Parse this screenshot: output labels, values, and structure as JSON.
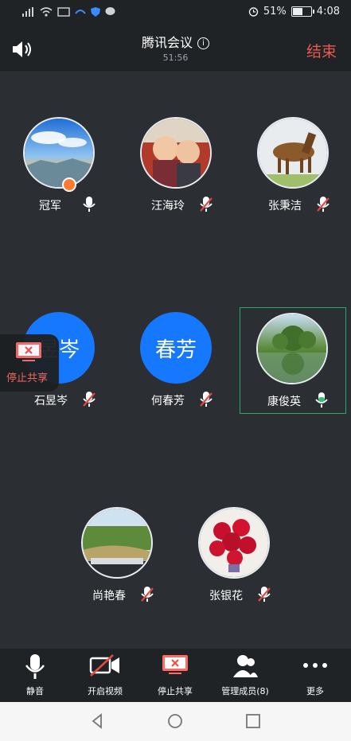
{
  "status": {
    "left_icons": [
      "signal-icon",
      "wifi-icon",
      "cast-icon",
      "app-icon",
      "shield-icon",
      "chat-icon"
    ],
    "battery": "51%",
    "battery_level": 0.51,
    "time": "4:08"
  },
  "header": {
    "title": "腾讯会议",
    "duration": "51:56",
    "end_label": "结束"
  },
  "members": [
    {
      "name": "冠军",
      "mic": "on",
      "avatar": "photo",
      "host": true
    },
    {
      "name": "汪海玲",
      "mic": "muted",
      "avatar": "photo"
    },
    {
      "name": "张秉洁",
      "mic": "muted",
      "avatar": "photo"
    },
    {
      "name": "石昱岑",
      "mic": "muted",
      "avatar": "text",
      "avatar_text": "昱岑"
    },
    {
      "name": "何春芳",
      "mic": "muted",
      "avatar": "text",
      "avatar_text": "春芳"
    },
    {
      "name": "康俊英",
      "mic": "speaking",
      "avatar": "photo",
      "active": true
    },
    {
      "name": "尚艳春",
      "mic": "muted",
      "avatar": "photo"
    },
    {
      "name": "张银花",
      "mic": "muted",
      "avatar": "photo"
    }
  ],
  "floating_share": {
    "label": "停止共享"
  },
  "toolbar": {
    "mute": "静音",
    "video": "开启视频",
    "share": "停止共享",
    "members": "管理成员(8)",
    "more": "更多"
  },
  "colors": {
    "accent_blue": "#1677ff",
    "end_red": "#e85a51",
    "mute_red": "#e5483f",
    "speaking_green": "#2fbf71"
  }
}
